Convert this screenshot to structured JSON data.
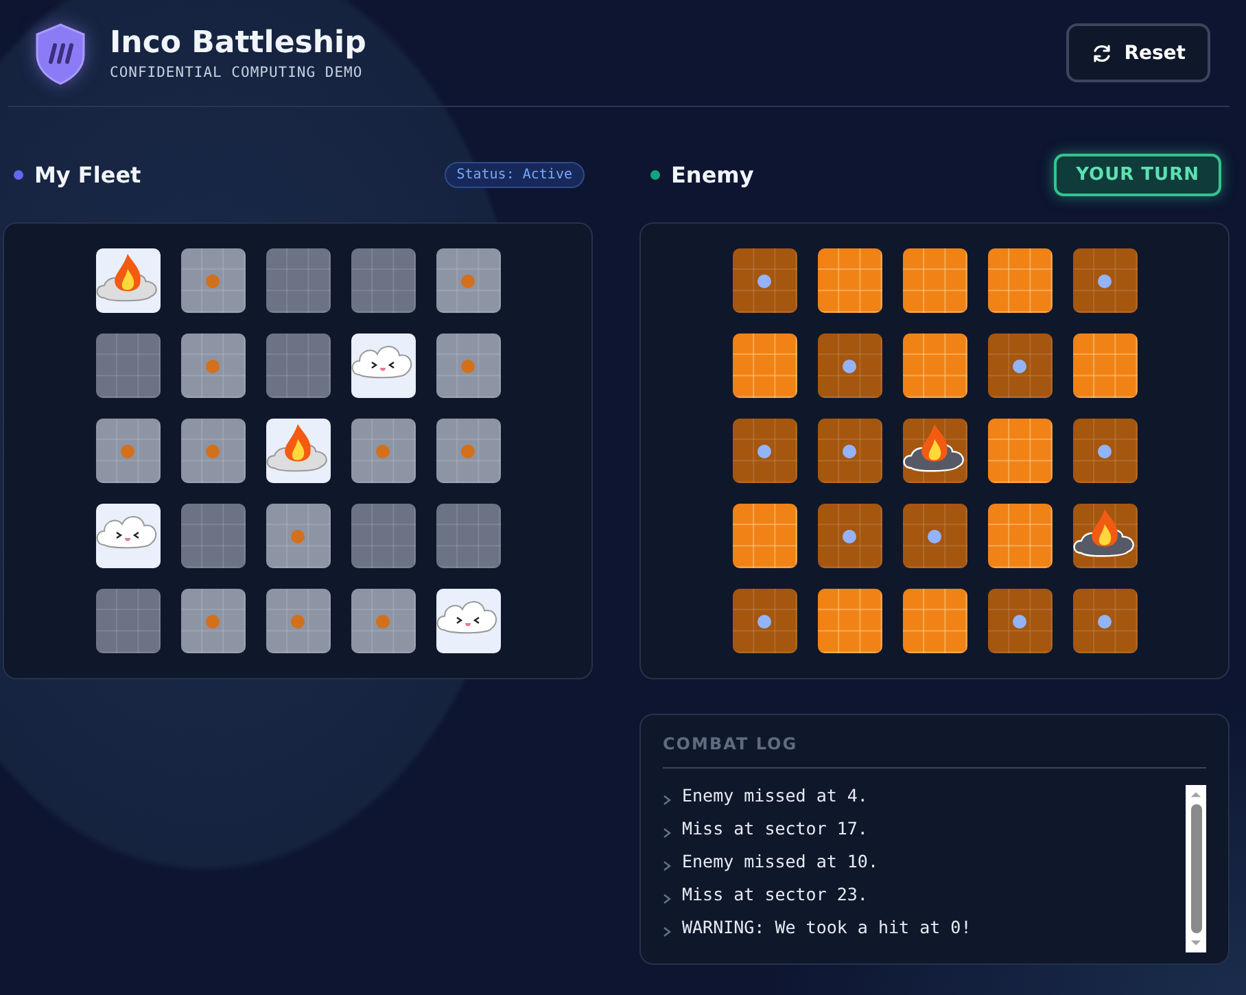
{
  "header": {
    "title": "Inco Battleship",
    "subtitle": "CONFIDENTIAL COMPUTING DEMO",
    "reset_button": "Reset"
  },
  "fleet": {
    "title": "My Fleet",
    "status": "Status: Active",
    "cells": [
      {
        "kind": "hit"
      },
      {
        "kind": "miss"
      },
      {
        "kind": "empty"
      },
      {
        "kind": "empty"
      },
      {
        "kind": "miss"
      },
      {
        "kind": "empty"
      },
      {
        "kind": "miss"
      },
      {
        "kind": "empty"
      },
      {
        "kind": "ship"
      },
      {
        "kind": "miss"
      },
      {
        "kind": "miss"
      },
      {
        "kind": "miss"
      },
      {
        "kind": "hit"
      },
      {
        "kind": "miss"
      },
      {
        "kind": "miss"
      },
      {
        "kind": "ship"
      },
      {
        "kind": "empty"
      },
      {
        "kind": "miss"
      },
      {
        "kind": "empty"
      },
      {
        "kind": "empty"
      },
      {
        "kind": "empty"
      },
      {
        "kind": "miss"
      },
      {
        "kind": "miss"
      },
      {
        "kind": "miss"
      },
      {
        "kind": "ship"
      }
    ]
  },
  "enemy": {
    "title": "Enemy",
    "turn_badge": "YOUR TURN",
    "cells": [
      {
        "kind": "miss"
      },
      {
        "kind": "unknown"
      },
      {
        "kind": "unknown"
      },
      {
        "kind": "unknown"
      },
      {
        "kind": "miss"
      },
      {
        "kind": "unknown"
      },
      {
        "kind": "miss"
      },
      {
        "kind": "unknown"
      },
      {
        "kind": "miss"
      },
      {
        "kind": "unknown"
      },
      {
        "kind": "miss"
      },
      {
        "kind": "miss"
      },
      {
        "kind": "hit"
      },
      {
        "kind": "unknown"
      },
      {
        "kind": "miss"
      },
      {
        "kind": "unknown"
      },
      {
        "kind": "miss"
      },
      {
        "kind": "miss"
      },
      {
        "kind": "unknown"
      },
      {
        "kind": "hit"
      },
      {
        "kind": "miss"
      },
      {
        "kind": "unknown"
      },
      {
        "kind": "unknown"
      },
      {
        "kind": "miss"
      },
      {
        "kind": "miss"
      }
    ]
  },
  "combat_log": {
    "title": "COMBAT LOG",
    "entries": [
      "Enemy missed at 4.",
      "Miss at sector 17.",
      "Enemy missed at 10.",
      "Miss at sector 23.",
      "WARNING: We took a hit at 0!"
    ]
  }
}
